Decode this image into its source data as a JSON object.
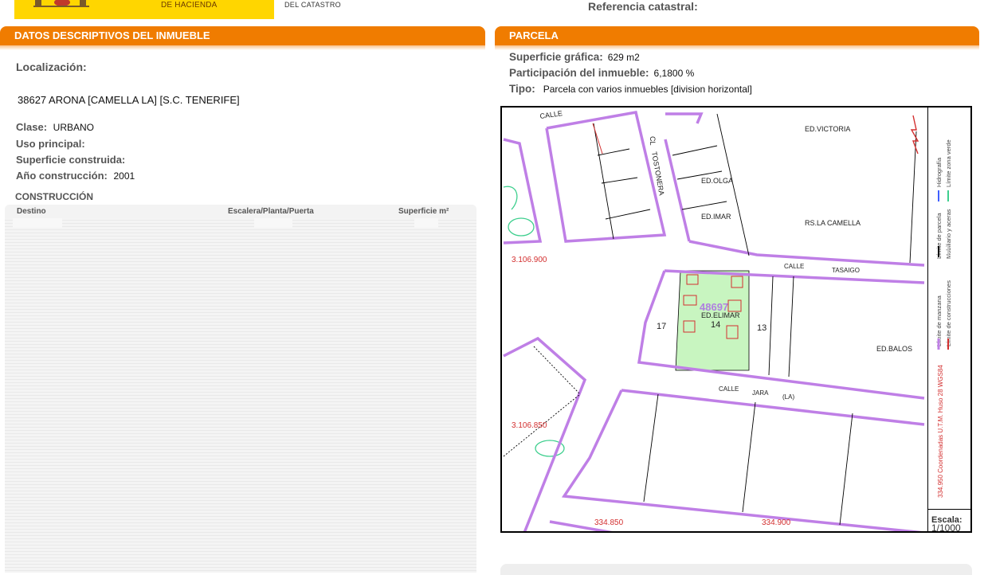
{
  "header": {
    "ministry_partial": "DE HACIENDA",
    "catastro_partial": "DEL CATASTRO",
    "referencia_label": "Referencia catastral:"
  },
  "left": {
    "section_title": "DATOS DESCRIPTIVOS DEL INMUEBLE",
    "localizacion_label": "Localización:",
    "localizacion_value": "38627 ARONA [CAMELLA LA] [S.C. TENERIFE]",
    "clase_label": "Clase:",
    "clase_value": "URBANO",
    "uso_label": "Uso principal:",
    "superficie_label": "Superficie construida:",
    "anio_label": "Año construcción:",
    "anio_value": "2001",
    "construccion_title": "CONSTRUCCIÓN",
    "table_headers": [
      "Destino",
      "Escalera/Planta/Puerta",
      "Superficie m²"
    ]
  },
  "right": {
    "section_title": "PARCELA",
    "superficie_grafica_label": "Superficie gráfica:",
    "superficie_grafica_value": "629 m2",
    "participacion_label": "Participación del inmueble:",
    "participacion_value": "6,1800 %",
    "tipo_label": "Tipo:",
    "tipo_value": "Parcela con varios inmuebles [division horizontal]"
  },
  "map": {
    "labels": {
      "calle_top": "CALLE",
      "cl": "CL",
      "tostonera": "TOSTONERA",
      "ed_victoria": "ED.VICTORIA",
      "ed_olga": "ED.OLGA",
      "ed_imar": "ED.IMAR",
      "rs_camella": "RS.LA CAMELLA",
      "calle_tasaigo_1": "CALLE",
      "calle_tasaigo_2": "TASAIGO",
      "parcel_ref": "48697",
      "ed_elimar": "ED.ELIMAR",
      "ed_balos": "ED.BALOS",
      "calle_jara_1": "CALLE",
      "calle_jara_2": "JARA",
      "calle_jara_3": "(LA)",
      "coord_y1": "3.106.900",
      "coord_y2": "3.106.850",
      "coord_x1": "334.850",
      "coord_x2": "334.900",
      "num_17": "17",
      "num_13": "13",
      "num_14": "14"
    },
    "legend": {
      "hidrografia": "Hidrografía",
      "limite_zona_verde": "Límite zona verde",
      "limite_parcela": "Límite de parcela",
      "mobiliario": "Mobiliario y aceras",
      "limite_manzana": "Límite de manzana",
      "limite_construcciones": "Límite de construcciones",
      "coordenadas": "334.950 Coordenadas U.T.M. Huso 28 WGS84"
    },
    "escala_label": "Escala:",
    "escala_value": "1/1000",
    "colors": {
      "manzana": "#bf7fe6",
      "construcciones": "#d32f2f",
      "parcela": "#000000",
      "zona_verde": "#3ecf8e",
      "parcel_fill": "#c8f5c0",
      "hidrografia": "#4060ff"
    }
  }
}
